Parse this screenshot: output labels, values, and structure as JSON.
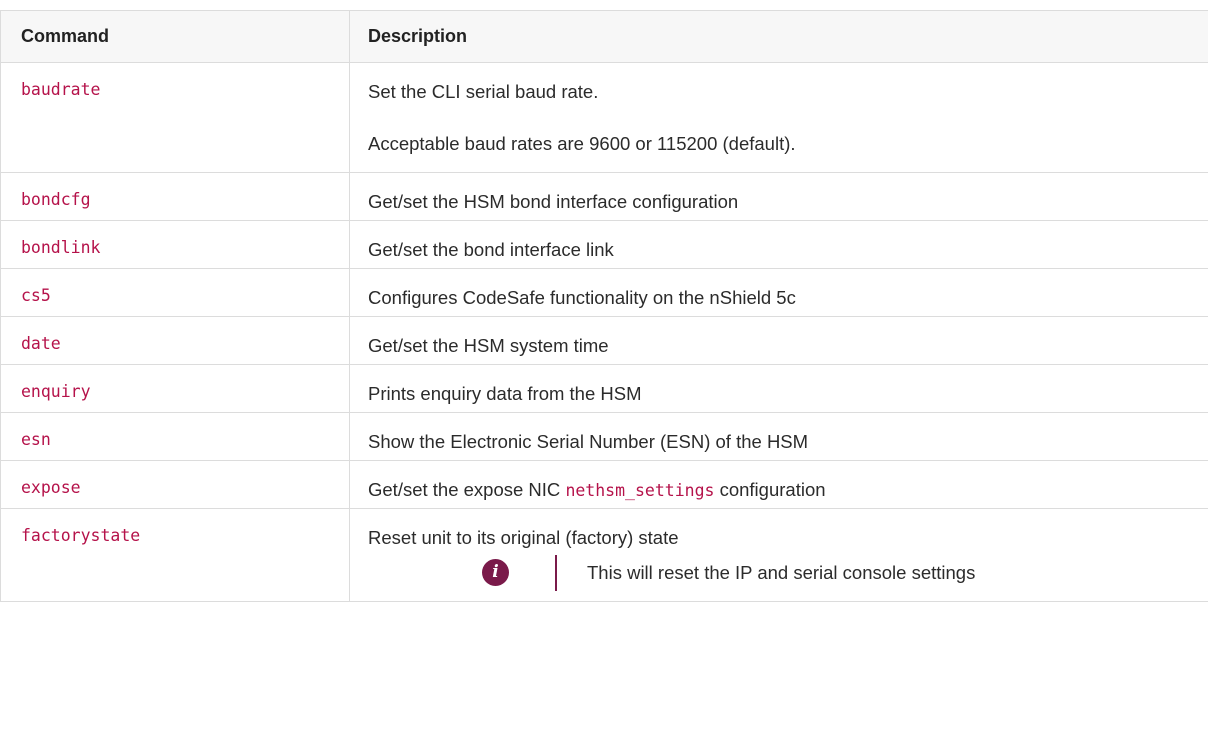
{
  "table": {
    "headers": {
      "command": "Command",
      "description": "Description"
    },
    "rows": [
      {
        "command": "baudrate",
        "description": "Set the CLI serial baud rate.",
        "description_extra": "Acceptable baud rates are 9600 or 115200 (default)."
      },
      {
        "command": "bondcfg",
        "description": "Get/set the HSM bond interface configuration"
      },
      {
        "command": "bondlink",
        "description": "Get/set the bond interface link"
      },
      {
        "command": "cs5",
        "description": "Configures CodeSafe functionality on the nShield 5c"
      },
      {
        "command": "date",
        "description": "Get/set the HSM system time"
      },
      {
        "command": "enquiry",
        "description": "Prints enquiry data from the HSM"
      },
      {
        "command": "esn",
        "description": "Show the Electronic Serial Number (ESN) of the HSM"
      },
      {
        "command": "expose",
        "description_before": "Get/set the expose NIC ",
        "description_code": "nethsm_settings",
        "description_after": " configuration"
      },
      {
        "command": "factorystate",
        "description": "Reset unit to its original (factory) state",
        "note": {
          "icon": "info-icon",
          "text": "This will reset the IP and serial console settings"
        }
      }
    ]
  }
}
